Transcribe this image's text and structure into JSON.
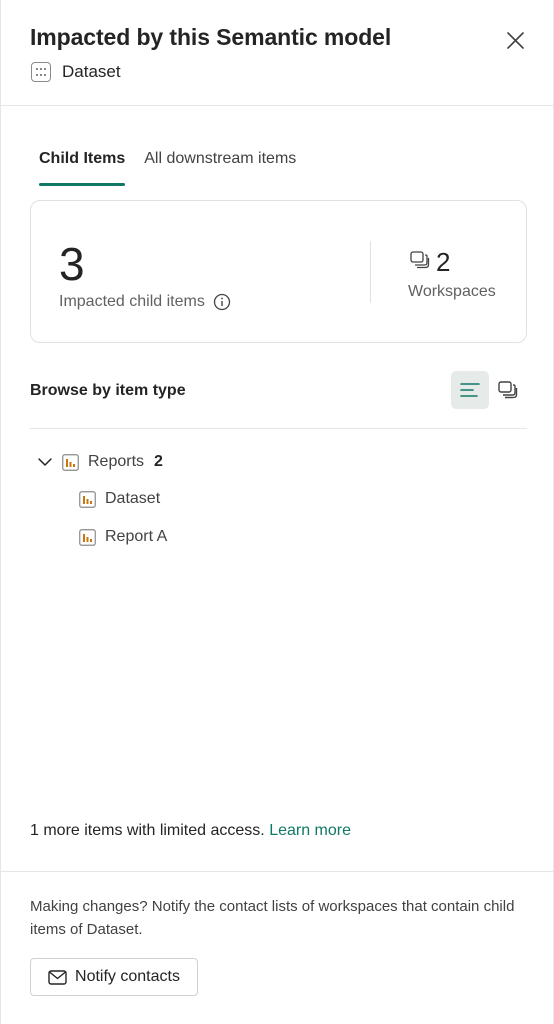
{
  "header": {
    "title": "Impacted by this Semantic model",
    "subtitle": "Dataset",
    "subtitle_icon": "dataset-icon",
    "close_icon": "close-icon"
  },
  "tabs": [
    {
      "label": "Child Items",
      "active": true
    },
    {
      "label": "All downstream items",
      "active": false
    }
  ],
  "summary": {
    "impacted_count": "3",
    "impacted_label": "Impacted child items",
    "workspaces_count": "2",
    "workspaces_label": "Workspaces"
  },
  "browse": {
    "label": "Browse by item type",
    "views": [
      "list-view-icon",
      "workspace-view-icon"
    ]
  },
  "tree": {
    "group": {
      "label": "Reports",
      "count": "2",
      "expanded": true
    },
    "items": [
      {
        "label": "Dataset"
      },
      {
        "label": "Report A"
      }
    ]
  },
  "limited": {
    "text": "1 more items with limited access.",
    "link": "Learn more"
  },
  "footer": {
    "text": "Making changes? Notify the contact lists of workspaces that contain child items of Dataset.",
    "button": "Notify contacts"
  },
  "colors": {
    "accent": "#117865",
    "report_icon": "#c8760f"
  }
}
